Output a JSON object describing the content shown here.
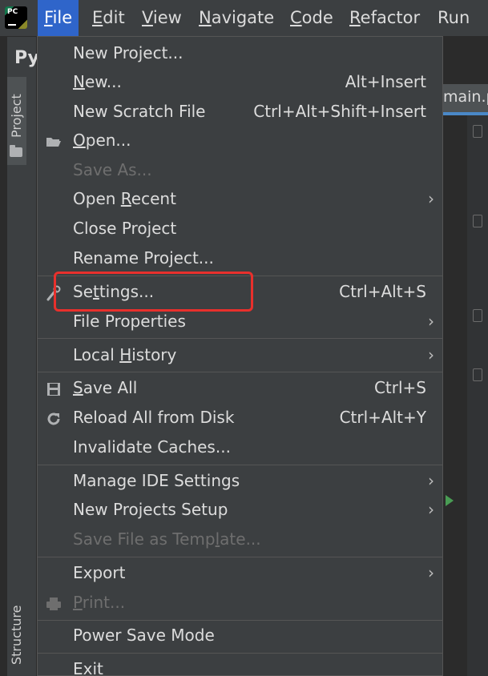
{
  "menubar": {
    "logo_text": "PC",
    "items": [
      {
        "label": "File",
        "mnemonic": "F",
        "rest": "ile",
        "active": true
      },
      {
        "label": "Edit",
        "mnemonic": "E",
        "rest": "dit"
      },
      {
        "label": "View",
        "mnemonic": "V",
        "rest": "iew"
      },
      {
        "label": "Navigate",
        "mnemonic": "N",
        "rest": "avigate"
      },
      {
        "label": "Code",
        "mnemonic": "C",
        "rest": "ode"
      },
      {
        "label": "Refactor",
        "mnemonic": "R",
        "rest": "efactor"
      },
      {
        "label": "Run",
        "mnemonic": "",
        "rest": "Run"
      }
    ]
  },
  "window": {
    "project_title": "Py",
    "project_tab": "Project",
    "structure_tab": "Structure",
    "editor_tab": "main.p"
  },
  "file_menu": {
    "new_project": "New Project...",
    "new": {
      "pre": "",
      "mn": "N",
      "post": "ew...",
      "shortcut": "Alt+Insert"
    },
    "new_scratch": {
      "label": "New Scratch File",
      "shortcut": "Ctrl+Alt+Shift+Insert"
    },
    "open": {
      "pre": "",
      "mn": "O",
      "post": "pen...",
      "icon": "folder-open-icon"
    },
    "save_as": "Save As...",
    "open_recent": {
      "pre": "Open ",
      "mn": "R",
      "post": "ecent"
    },
    "close_project": "Close Project",
    "rename_project": "Rename Project...",
    "settings": {
      "pre": "Se",
      "mn": "t",
      "post": "tings...",
      "shortcut": "Ctrl+Alt+S",
      "icon": "wrench-icon"
    },
    "file_properties": "File Properties",
    "local_history": {
      "pre": "Local ",
      "mn": "H",
      "post": "istory"
    },
    "save_all": {
      "pre": "",
      "mn": "S",
      "post": "ave All",
      "shortcut": "Ctrl+S",
      "icon": "save-icon"
    },
    "reload": {
      "label": "Reload All from Disk",
      "shortcut": "Ctrl+Alt+Y",
      "icon": "reload-icon"
    },
    "invalidate": "Invalidate Caches...",
    "manage_ide": "Manage IDE Settings",
    "new_projects_setup": "New Projects Setup",
    "save_as_template": {
      "pre": "Save File as Temp",
      "mn": "l",
      "post": "ate..."
    },
    "export": "Export",
    "print": {
      "pre": "",
      "mn": "P",
      "post": "rint...",
      "icon": "printer-icon"
    },
    "power_save": "Power Save Mode",
    "exit": {
      "pre": "E",
      "mn": "x",
      "post": "it"
    },
    "submenu_arrow": "›"
  },
  "colors": {
    "background": "#3c3f41",
    "menu_active": "#2f65ca",
    "highlight": "#e8302c",
    "disabled_text": "#6e6e6e"
  }
}
